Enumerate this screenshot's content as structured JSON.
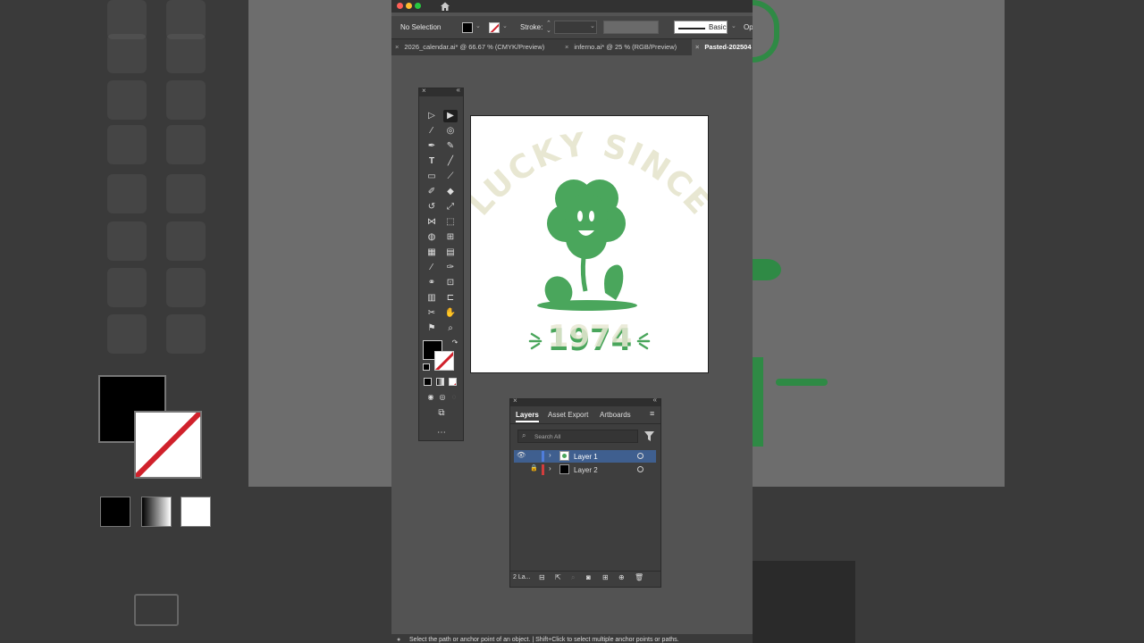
{
  "control_bar": {
    "selection": "No Selection",
    "stroke_label": "Stroke:",
    "brush_label": "Basic",
    "opacity_label": "Op"
  },
  "tabs": [
    {
      "label": "2026_calendar.ai* @ 66.67 % (CMYK/Preview)"
    },
    {
      "label": "inferno.ai* @ 25 % (RGB/Preview)"
    },
    {
      "label": "Pasted-202504"
    }
  ],
  "artwork": {
    "headline": "LUCKY SINCE",
    "year": "1974",
    "headline_color": "#e8e7d2",
    "clover_color": "#4aa65c"
  },
  "layers_panel": {
    "tabs": [
      "Layers",
      "Asset Export",
      "Artboards"
    ],
    "search_placeholder": "Search All",
    "layers": [
      {
        "name": "Layer 1",
        "color": "#4f7ddb"
      },
      {
        "name": "Layer 2",
        "color": "#d23d3d"
      }
    ],
    "footer_count": "2 La..."
  },
  "status_bar": {
    "text": "Select the path or anchor point of an object.  |  Shift+Click to select multiple anchor points or paths."
  },
  "colors": {
    "app_bg": "#535353",
    "panel_bg": "#3e3e3e",
    "selected_row": "#3f5f8f"
  }
}
